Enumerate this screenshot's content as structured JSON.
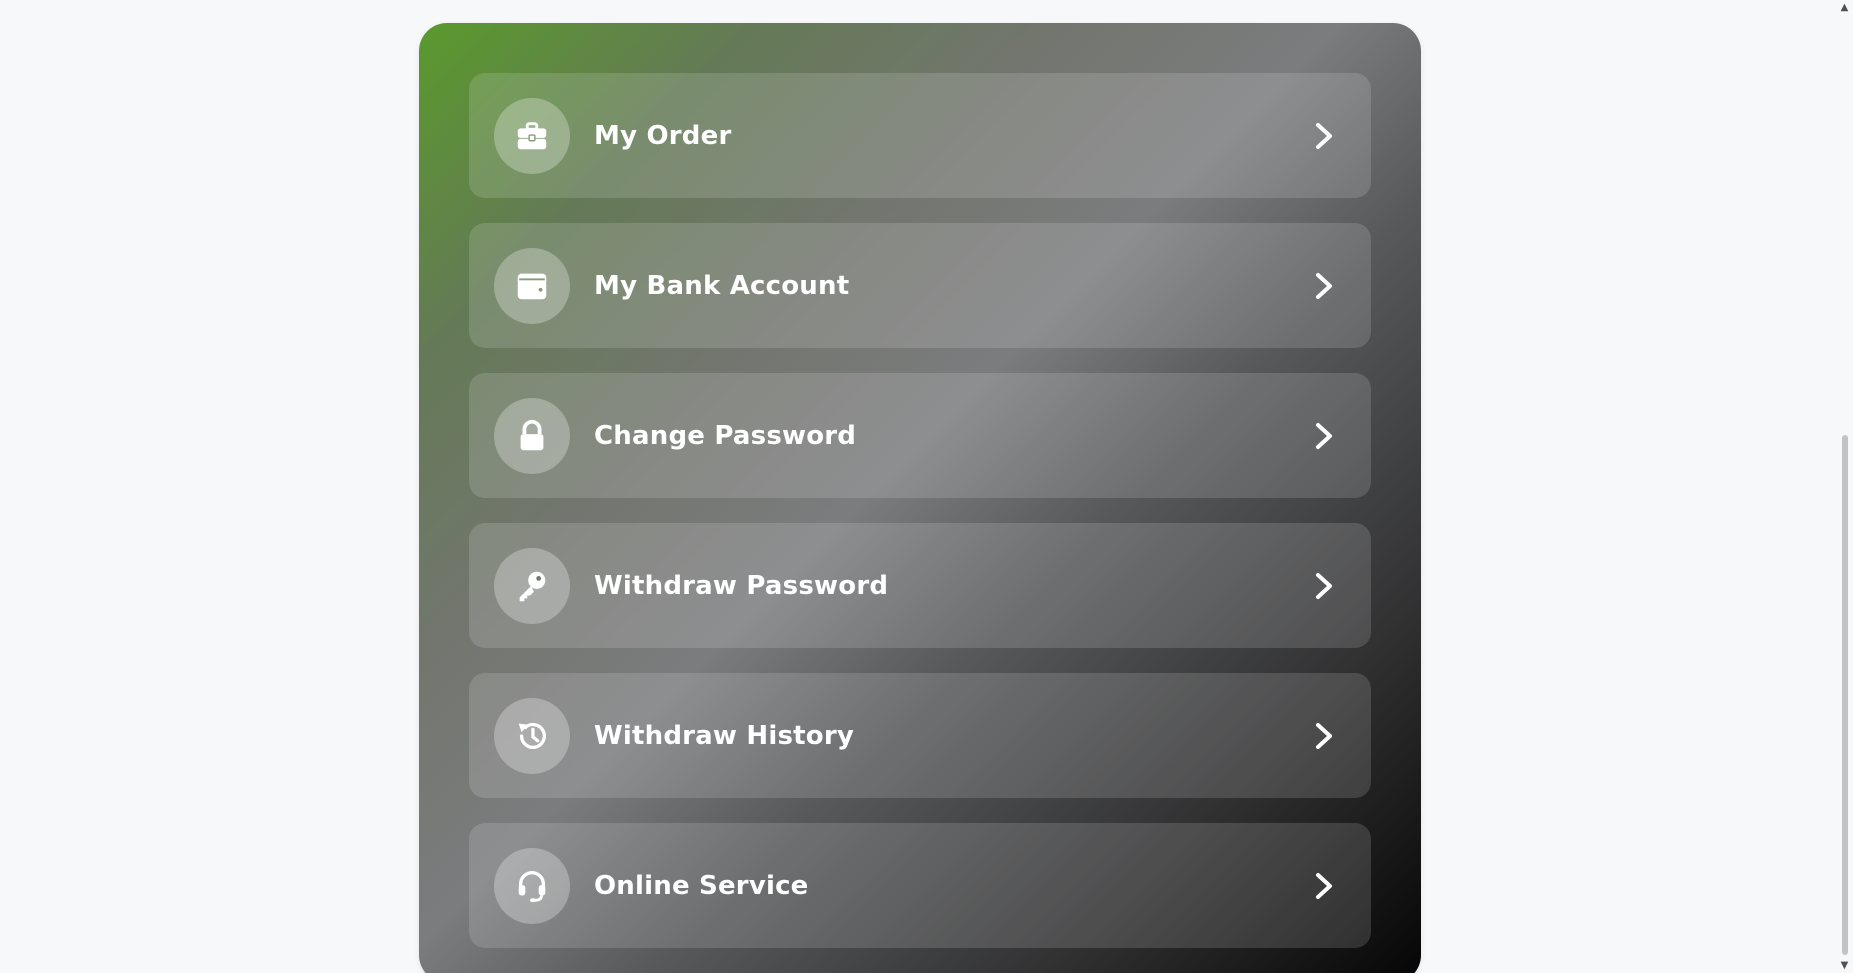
{
  "menu": {
    "items": [
      {
        "label": "My Order",
        "icon": "briefcase-icon"
      },
      {
        "label": "My Bank Account",
        "icon": "wallet-icon"
      },
      {
        "label": "Change Password",
        "icon": "lock-icon"
      },
      {
        "label": "Withdraw Password",
        "icon": "key-icon"
      },
      {
        "label": "Withdraw History",
        "icon": "history-icon"
      },
      {
        "label": "Online Service",
        "icon": "headset-icon"
      }
    ]
  },
  "colors": {
    "gradient_start": "#5a9a2c",
    "gradient_mid": "#7b7c7e",
    "gradient_end": "#050505",
    "text": "#ffffff",
    "page_background": "#f7f8fa"
  }
}
